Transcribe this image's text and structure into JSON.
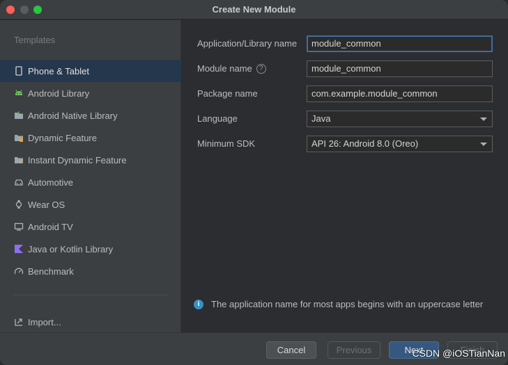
{
  "window": {
    "title": "Create New Module"
  },
  "sidebar": {
    "heading": "Templates",
    "items": [
      {
        "label": "Phone & Tablet",
        "icon": "phone-tablet-icon",
        "selected": true
      },
      {
        "label": "Android Library",
        "icon": "android-icon"
      },
      {
        "label": "Android Native Library",
        "icon": "folder-native-icon"
      },
      {
        "label": "Dynamic Feature",
        "icon": "folder-dynamic-icon"
      },
      {
        "label": "Instant Dynamic Feature",
        "icon": "folder-instant-icon"
      },
      {
        "label": "Automotive",
        "icon": "car-icon"
      },
      {
        "label": "Wear OS",
        "icon": "watch-icon"
      },
      {
        "label": "Android TV",
        "icon": "tv-icon"
      },
      {
        "label": "Java or Kotlin Library",
        "icon": "kotlin-icon"
      },
      {
        "label": "Benchmark",
        "icon": "gauge-icon"
      }
    ],
    "import_label": "Import..."
  },
  "form": {
    "app_name_label": "Application/Library name",
    "app_name_value": "module_common",
    "module_name_label": "Module name",
    "module_name_value": "module_common",
    "package_name_label": "Package name",
    "package_name_value": "com.example.module_common",
    "language_label": "Language",
    "language_value": "Java",
    "min_sdk_label": "Minimum SDK",
    "min_sdk_value": "API 26: Android 8.0 (Oreo)"
  },
  "hint": {
    "text": "The application name for most apps begins with an uppercase letter"
  },
  "buttons": {
    "cancel": "Cancel",
    "previous": "Previous",
    "next": "Next",
    "finish": "Finish"
  },
  "watermark": "CSDN @iOSTianNan",
  "colors": {
    "selected_bg": "#25374c",
    "accent_blue": "#3592c4",
    "primary_button": "#365880"
  }
}
